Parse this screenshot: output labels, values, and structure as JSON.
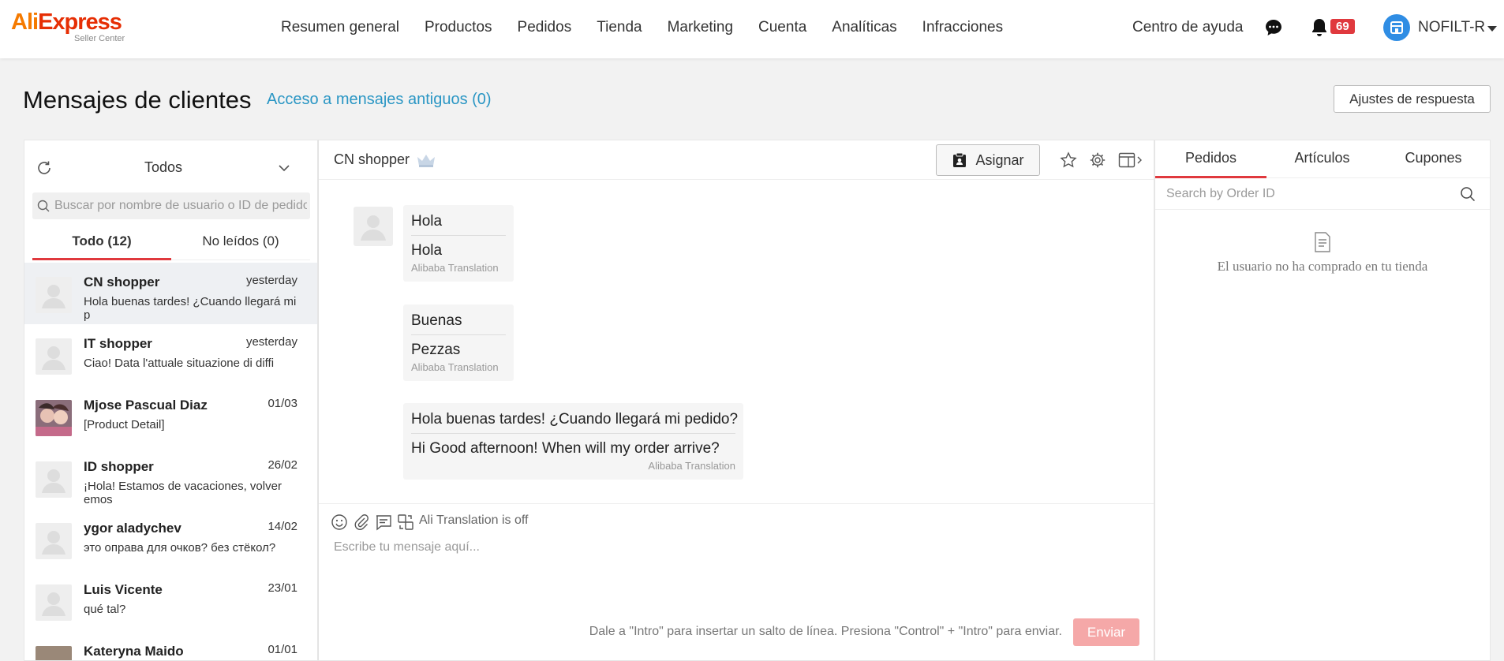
{
  "brand": {
    "logo_ali": "Ali",
    "logo_express": "Express",
    "logo_sub": "Seller Center"
  },
  "nav": {
    "items": [
      {
        "label": "Resumen general"
      },
      {
        "label": "Productos"
      },
      {
        "label": "Pedidos"
      },
      {
        "label": "Tienda"
      },
      {
        "label": "Marketing"
      },
      {
        "label": "Cuenta"
      },
      {
        "label": "Analíticas"
      },
      {
        "label": "Infracciones"
      }
    ],
    "help": "Centro de ayuda",
    "notifications_count": "69",
    "account_name": "NOFILT-R"
  },
  "page": {
    "title": "Mensajes de clientes",
    "old_messages_link": "Acceso a mensajes antiguos (0)",
    "reply_settings": "Ajustes de respuesta"
  },
  "left": {
    "filter": "Todos",
    "search_placeholder": "Buscar por nombre de usuario o ID de pedido",
    "tabs": [
      {
        "label": "Todo (12)"
      },
      {
        "label": "No leídos (0)"
      }
    ],
    "conversations": [
      {
        "name": "CN shopper",
        "time": "yesterday",
        "preview": "Hola buenas tardes! ¿Cuando llegará mi p"
      },
      {
        "name": "IT shopper",
        "time": "yesterday",
        "preview": "Ciao! Data l'attuale situazione di diffi"
      },
      {
        "name": "Mjose Pascual Diaz",
        "time": "01/03",
        "preview": "[Product Detail]"
      },
      {
        "name": "ID shopper",
        "time": "26/02",
        "preview": "¡Hola! Estamos de vacaciones, volver emos"
      },
      {
        "name": "ygor aladychev",
        "time": "14/02",
        "preview": "это оправа для очков? без стёкол?"
      },
      {
        "name": "Luis Vicente",
        "time": "23/01",
        "preview": "qué tal?"
      },
      {
        "name": "Kateryna Maido",
        "time": "01/01",
        "preview": ""
      }
    ]
  },
  "chat": {
    "peer_name": "CN shopper",
    "assign_label": "Asignar",
    "messages": [
      {
        "original": "Hola",
        "translation": "Hola",
        "tag": "Alibaba Translation"
      },
      {
        "original": "Buenas",
        "translation": "Pezzas",
        "tag": "Alibaba Translation"
      },
      {
        "original": "Hola buenas tardes! ¿Cuando llegará mi pedido?",
        "translation": "Hi Good afternoon! When will my order arrive?",
        "tag": "Alibaba Translation"
      }
    ],
    "translation_status": "Ali Translation is off",
    "input_placeholder": "Escribe tu mensaje aquí...",
    "hint": "Dale a \"Intro\" para insertar un salto de línea. Presiona \"Control\" + \"Intro\" para enviar.",
    "send_label": "Enviar"
  },
  "right": {
    "tabs": [
      {
        "label": "Pedidos"
      },
      {
        "label": "Artículos"
      },
      {
        "label": "Cupones"
      }
    ],
    "order_search_placeholder": "Search by Order ID",
    "empty_text": "El usuario no ha comprado en tu tienda"
  },
  "colors": {
    "accent": "#e0393e",
    "link": "#2a96c4",
    "brand_orange": "#f57a00",
    "brand_red": "#e62e04"
  }
}
